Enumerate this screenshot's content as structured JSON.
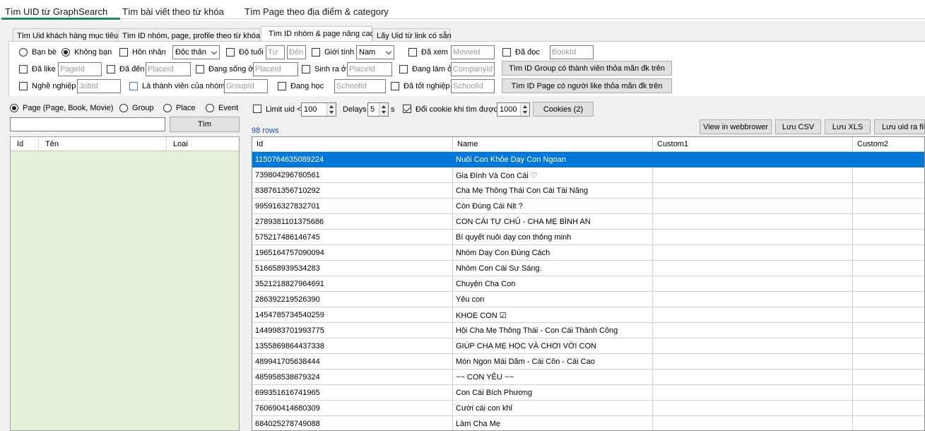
{
  "top_tabs": [
    {
      "label": "Tìm UID từ GraphSearch",
      "active": true
    },
    {
      "label": "Tìm bài viết theo từ khóa",
      "active": false
    },
    {
      "label": "Tìm Page theo địa điểm & category",
      "active": false
    }
  ],
  "sub_tabs": [
    {
      "label": "Tìm Uid khách hàng mục tiêu"
    },
    {
      "label": "Tìm ID nhóm, page,  profile theo từ khóa"
    },
    {
      "label": "Tìm ID nhóm & page nâng cao",
      "active": true
    },
    {
      "label": "Lấy Uid từ link có sẵn"
    }
  ],
  "filters": {
    "ban_be": "Bạn bè",
    "khong_ban": "Không bạn",
    "hon_nhan": "Hôn nhân",
    "hon_nhan_value": "Độc thân",
    "do_tuoi": "Độ tuổi",
    "tu_placeholder": "Từ",
    "den_placeholder": "Đến",
    "gioi_tinh": "Giới tính",
    "gioi_tinh_value": "Nam",
    "da_xem": "Đã xem",
    "movie_placeholder": "MovieId",
    "da_doc": "Đã đọc",
    "book_placeholder": "BookId",
    "da_like": "Đã like",
    "page_placeholder": "PageId",
    "da_den": "Đã đến",
    "place_placeholder": "PlaceId",
    "dang_song": "Đang sống ở",
    "sinh_ra": "Sinh ra ở",
    "dang_lam": "Đang làm ở",
    "company_placeholder": "CompanyId",
    "btn_group": "Tìm ID Group có thành viên thỏa mãn đk trên",
    "nghe_nghiep": "Nghề nghiệp",
    "job_placeholder": "JobId",
    "thanh_vien": "Là thành viên của nhóm",
    "group_placeholder": "GroupId",
    "dang_hoc": "Đang học",
    "school_placeholder": "SchoolId",
    "da_tot_nghiep": "Đã tốt nghiệp",
    "btn_page": "Tìm ID Page có người like thỏa mãn đk trên"
  },
  "search_type": {
    "page": "Page (Page, Book, Movie)",
    "group": "Group",
    "place": "Place",
    "event": "Event"
  },
  "search": {
    "input_value": "",
    "button": "Tìm"
  },
  "left_grid": {
    "columns": [
      "Id",
      "Tên",
      "Loại"
    ]
  },
  "options": {
    "limit_uid": "Limit uid <",
    "limit_value": "100",
    "delays": "Delays",
    "delays_value": "5",
    "delays_unit": "s",
    "doi_cookie": "Đổi cookie khi tìm được",
    "cookie_value": "1000",
    "cookies_button": "Cookies (2)"
  },
  "row_count": "98 rows",
  "toolbar": {
    "view_browser": "View in webbrower",
    "luu_csv": "Lưu CSV",
    "luu_xls": "Lưu XLS",
    "luu_uid": "Lưu uid ra file"
  },
  "main_grid": {
    "columns": [
      "Id",
      "Name",
      "Custom1",
      "Custom2"
    ],
    "rows": [
      {
        "id": "1150764635089224",
        "name": "Nuôi Con Khỏe Dạy Con Ngoan"
      },
      {
        "id": "739804296780561",
        "name": "Gia Đình Và Con Cái ♡"
      },
      {
        "id": "838761356710292",
        "name": "Cha Mẹ Thông Thái Con Cái Tài Năng"
      },
      {
        "id": "995916327832701",
        "name": "Còn Đúng Cái Nịt ?"
      },
      {
        "id": "2789381101375686",
        "name": "CON CÁI TỰ CHỦ - CHA MẸ BÌNH AN"
      },
      {
        "id": "575217486146745",
        "name": "Bí quyết nuôi dạy con thông minh"
      },
      {
        "id": "1965164757090094",
        "name": "Nhóm Dạy Con Đúng Cách"
      },
      {
        "id": "516658939534283",
        "name": "Nhóm Con Cái Sự Sáng."
      },
      {
        "id": "3521218827964691",
        "name": "Chuyện Cha Con"
      },
      {
        "id": "286392219526390",
        "name": "Yêu con"
      },
      {
        "id": "1454785734540259",
        "name": "KHOE CON ☑"
      },
      {
        "id": "1449983701993775",
        "name": "Hội Cha Mẹ Thông Thái - Con Cái Thành Công"
      },
      {
        "id": "1355869864437338",
        "name": "GIÚP CHA MẸ HỌC VÀ CHƠI VỚI CON"
      },
      {
        "id": "489941705638444",
        "name": "Món Ngon Mái Dăm - Cái Côn - Cái Cao"
      },
      {
        "id": "485958538679324",
        "name": "~~ CON YÊU  ~~"
      },
      {
        "id": "699351616741965",
        "name": "Con Cái Bích Phương"
      },
      {
        "id": "760690414680309",
        "name": "Cười cái con khỉ"
      },
      {
        "id": "684025278749088",
        "name": "Làm Cha Mẹ"
      }
    ]
  }
}
